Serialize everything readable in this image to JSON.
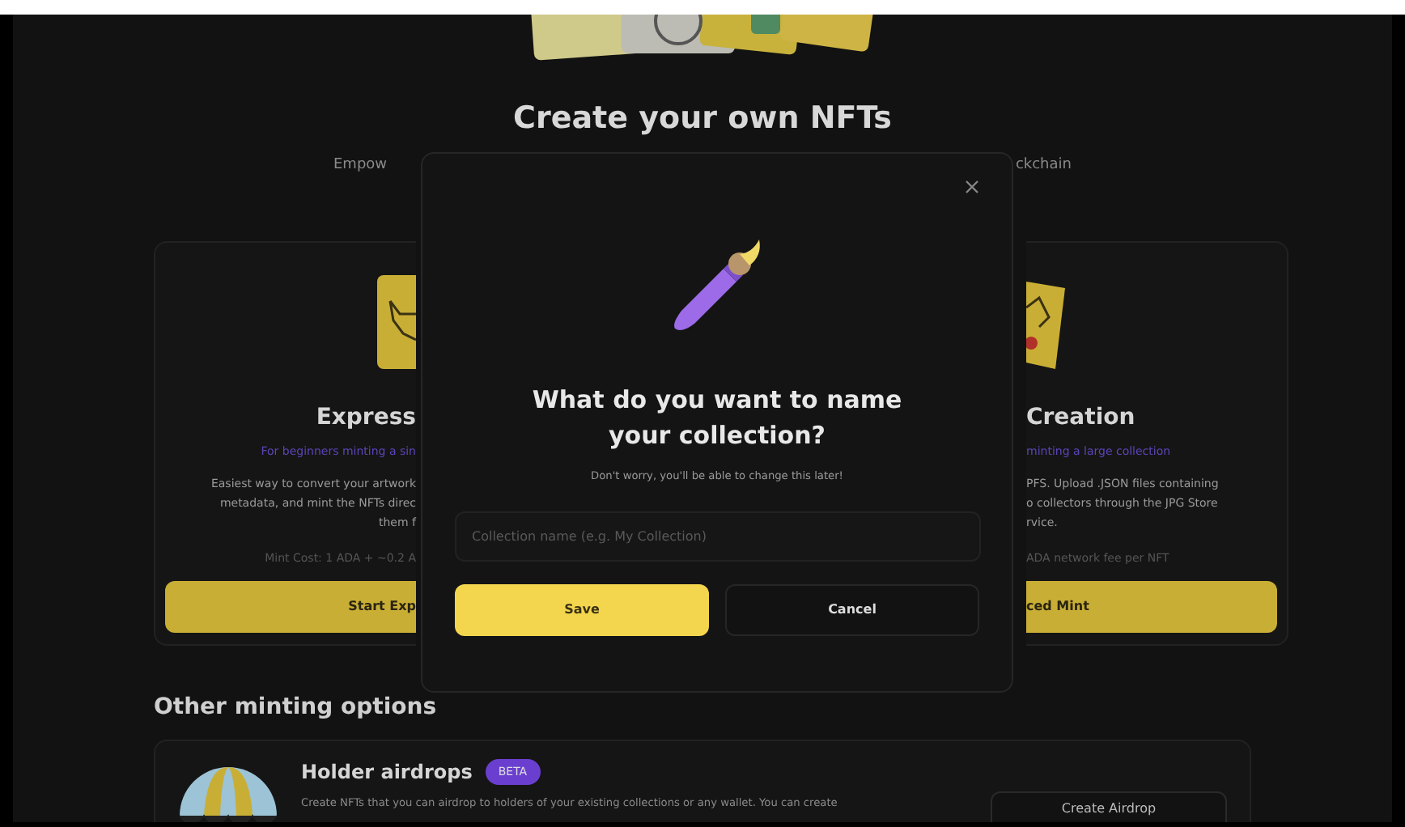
{
  "hero": {
    "title": "Create your own NFTs",
    "subtitle_fragments": [
      "Empow",
      "ckchain"
    ]
  },
  "cards": [
    {
      "title": "Express",
      "tagline": "For beginners minting a sin",
      "description_lines": [
        "Easiest way to convert your artwork",
        "metadata, and mint the NFTs direc",
        "them f"
      ],
      "cost": "Mint Cost: 1 ADA + ~0.2 A",
      "button": "Start Exp"
    },
    {
      "title": "Creation",
      "tagline": "minting a large collection",
      "description_lines": [
        "PFS. Upload .JSON files containing",
        "o collectors through the JPG Store",
        "rvice."
      ],
      "cost": "ADA network fee per NFT",
      "button": "ced Mint"
    }
  ],
  "other_options": {
    "heading": "Other minting options",
    "items": [
      {
        "title": "Holder airdrops",
        "badge": "BETA",
        "description": "Create NFTs that you can airdrop to holders of your existing collections or any wallet. You can create",
        "button": "Create Airdrop"
      }
    ]
  },
  "modal": {
    "title": "What do you want to name your collection?",
    "subtitle": "Don't worry, you'll be able to change this later!",
    "input": {
      "placeholder": "Collection name (e.g. My Collection)"
    },
    "buttons": [
      {
        "label": "Save",
        "kind": "primary"
      },
      {
        "label": "Cancel",
        "kind": "secondary"
      }
    ]
  }
}
